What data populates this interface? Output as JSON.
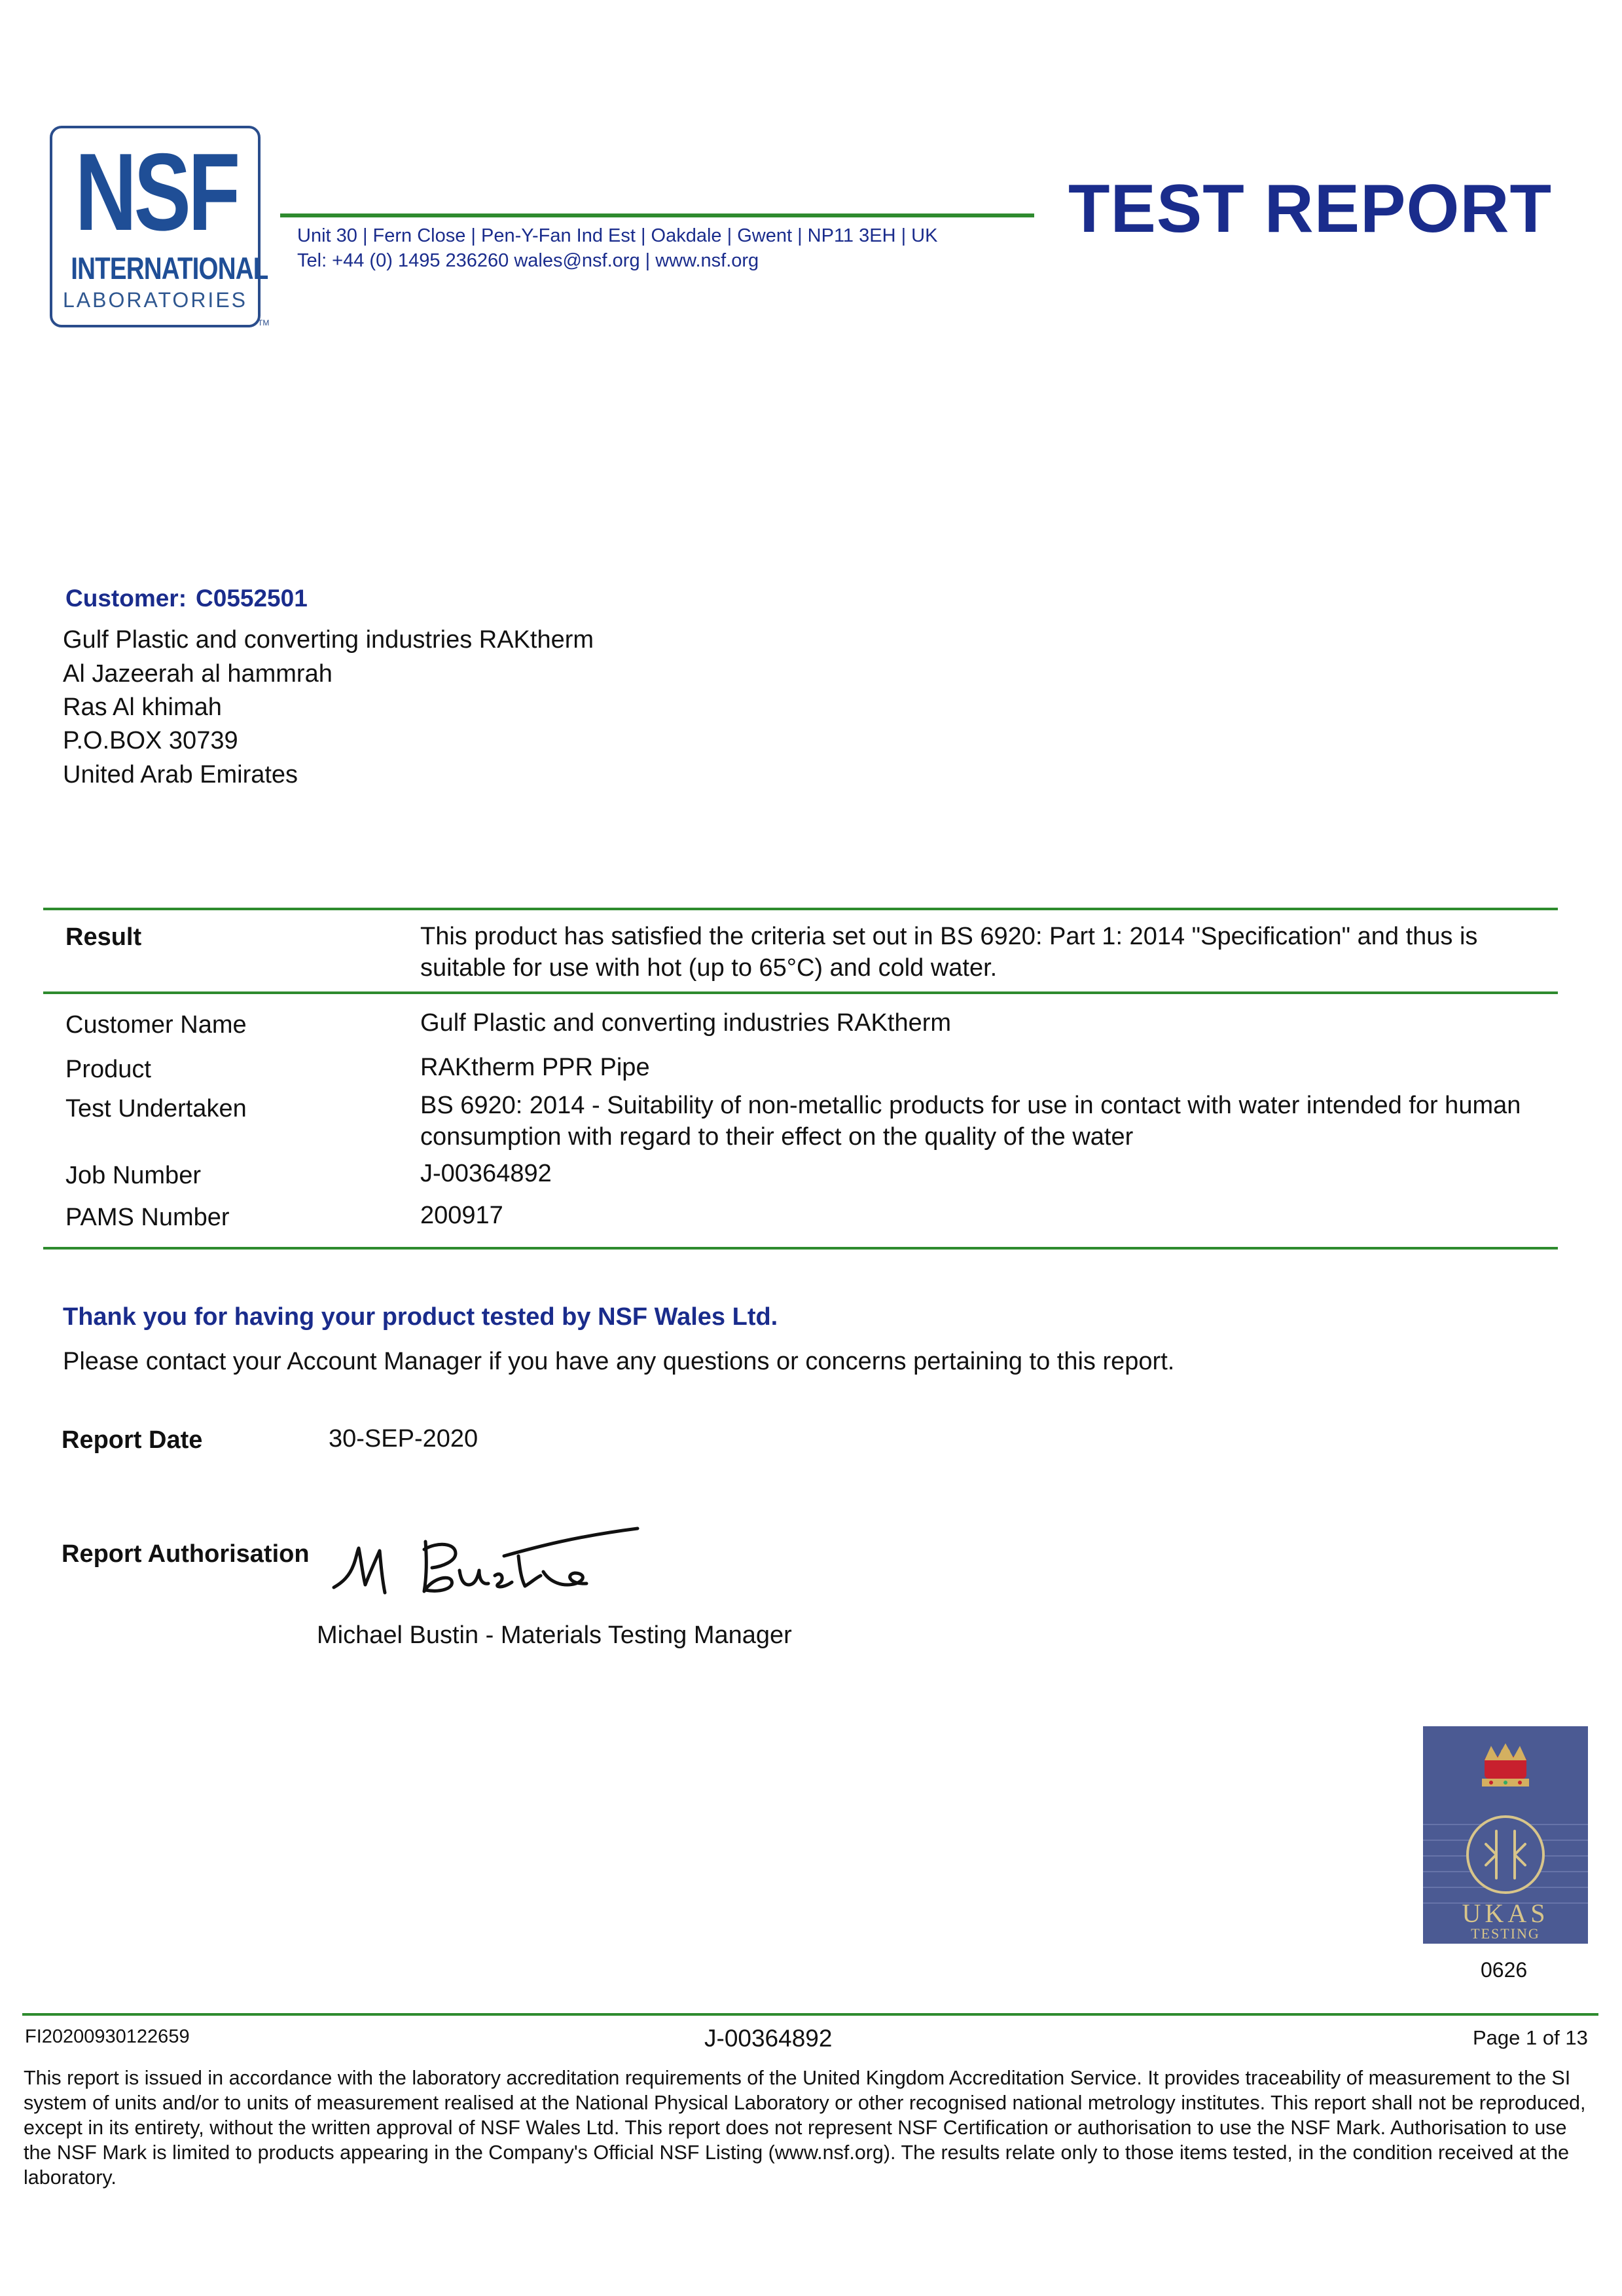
{
  "logo": {
    "line1": "NSF",
    "line2": "INTERNATIONAL",
    "line3": "LABORATORIES",
    "tm": "TM",
    "color": "#1f4e96"
  },
  "header": {
    "address_line1": "Unit 30 | Fern Close | Pen-Y-Fan Ind Est | Oakdale | Gwent | NP11 3EH | UK",
    "address_line2": "Tel: +44 (0) 1495 236260 wales@nsf.org | www.nsf.org",
    "title": "TEST REPORT"
  },
  "customer": {
    "label": "Customer:",
    "code": "C0552501",
    "address": [
      "Gulf Plastic and converting industries RAKtherm",
      "Al Jazeerah al hammrah",
      "Ras Al khimah",
      "P.O.BOX 30739",
      "United Arab Emirates"
    ]
  },
  "result": {
    "label": "Result",
    "text": "This product has satisfied the criteria set out in BS 6920: Part 1: 2014 \"Specification\" and thus is suitable for use with hot (up to 65°C) and cold water."
  },
  "details": [
    {
      "label": "Customer Name",
      "value": "Gulf Plastic and converting industries RAKtherm"
    },
    {
      "label": "Product",
      "value": "RAKtherm PPR Pipe"
    },
    {
      "label": "Test Undertaken",
      "value": "BS 6920: 2014 - Suitability of non-metallic products for use in contact with water intended for human consumption with regard to their effect on the quality of the water"
    },
    {
      "label": "Job Number",
      "value": "J-00364892"
    },
    {
      "label": "PAMS Number",
      "value": "200917"
    }
  ],
  "thanks": {
    "heading": "Thank you for having your product tested by NSF Wales Ltd.",
    "contact": "Please contact your Account Manager if you have any questions or concerns pertaining to this report."
  },
  "report_date": {
    "label": "Report Date",
    "value": "30-SEP-2020"
  },
  "authorisation": {
    "label": "Report Authorisation",
    "signer": "Michael Bustin - Materials Testing Manager"
  },
  "ukas": {
    "text": "UKAS",
    "subtext": "TESTING",
    "number": "0626",
    "background": "#4b5a93"
  },
  "footer": {
    "doc_id": "FI20200930122659",
    "job": "J-00364892",
    "page": "Page 1 of 13",
    "disclaimer": "This report is issued in accordance with the laboratory accreditation requirements of the United Kingdom Accreditation Service. It provides traceability of measurement to the SI system of units and/or to units of measurement realised at the National Physical Laboratory or other recognised national metrology institutes. This report shall not be reproduced, except in its entirety, without the written approval of NSF Wales Ltd. This report does not represent NSF Certification or authorisation to use the NSF Mark. Authorisation to use the NSF Mark is limited to products appearing in the Company's Official NSF Listing (www.nsf.org). The results relate only to those items tested, in the condition received at the laboratory."
  },
  "colors": {
    "navy": "#1a2c8c",
    "green_rule": "#2e8b2e"
  }
}
